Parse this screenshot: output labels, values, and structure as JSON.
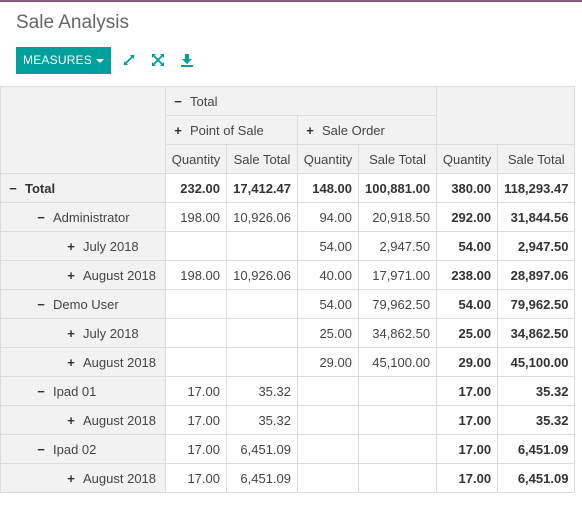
{
  "page": {
    "title": "Sale Analysis"
  },
  "toolbar": {
    "measures_label": "MEASURES"
  },
  "icons": {
    "expand": "expand-arrows-icon",
    "fullscreen": "fullscreen-icon",
    "download": "download-icon"
  },
  "colors": {
    "accent": "#00a09d",
    "header_bg": "#f2f2f2",
    "border": "#dcdcdc",
    "topline": "#875a7b"
  },
  "columns": {
    "total_label": "Total",
    "groups": [
      {
        "label": "Point of Sale"
      },
      {
        "label": "Sale Order"
      }
    ],
    "measures": [
      "Quantity",
      "Sale Total",
      "Quantity",
      "Sale Total",
      "Quantity",
      "Sale Total"
    ]
  },
  "rows": [
    {
      "label": "Total",
      "sign": "−",
      "level": 0,
      "bold_all": true,
      "cells": [
        "232.00",
        "17,412.47",
        "148.00",
        "100,881.00",
        "380.00",
        "118,293.47"
      ]
    },
    {
      "label": "Administrator",
      "sign": "−",
      "level": 1,
      "cells": [
        "198.00",
        "10,926.06",
        "94.00",
        "20,918.50",
        "292.00",
        "31,844.56"
      ]
    },
    {
      "label": "July 2018",
      "sign": "+",
      "level": 2,
      "cells": [
        "",
        "",
        "54.00",
        "2,947.50",
        "54.00",
        "2,947.50"
      ]
    },
    {
      "label": "August 2018",
      "sign": "+",
      "level": 2,
      "cells": [
        "198.00",
        "10,926.06",
        "40.00",
        "17,971.00",
        "238.00",
        "28,897.06"
      ]
    },
    {
      "label": "Demo User",
      "sign": "−",
      "level": 1,
      "cells": [
        "",
        "",
        "54.00",
        "79,962.50",
        "54.00",
        "79,962.50"
      ]
    },
    {
      "label": "July 2018",
      "sign": "+",
      "level": 2,
      "cells": [
        "",
        "",
        "25.00",
        "34,862.50",
        "25.00",
        "34,862.50"
      ]
    },
    {
      "label": "August 2018",
      "sign": "+",
      "level": 2,
      "cells": [
        "",
        "",
        "29.00",
        "45,100.00",
        "29.00",
        "45,100.00"
      ]
    },
    {
      "label": "Ipad 01",
      "sign": "−",
      "level": 1,
      "cells": [
        "17.00",
        "35.32",
        "",
        "",
        "17.00",
        "35.32"
      ]
    },
    {
      "label": "August 2018",
      "sign": "+",
      "level": 2,
      "cells": [
        "17.00",
        "35.32",
        "",
        "",
        "17.00",
        "35.32"
      ]
    },
    {
      "label": "Ipad 02",
      "sign": "−",
      "level": 1,
      "cells": [
        "17.00",
        "6,451.09",
        "",
        "",
        "17.00",
        "6,451.09"
      ]
    },
    {
      "label": "August 2018",
      "sign": "+",
      "level": 2,
      "cells": [
        "17.00",
        "6,451.09",
        "",
        "",
        "17.00",
        "6,451.09"
      ]
    }
  ]
}
